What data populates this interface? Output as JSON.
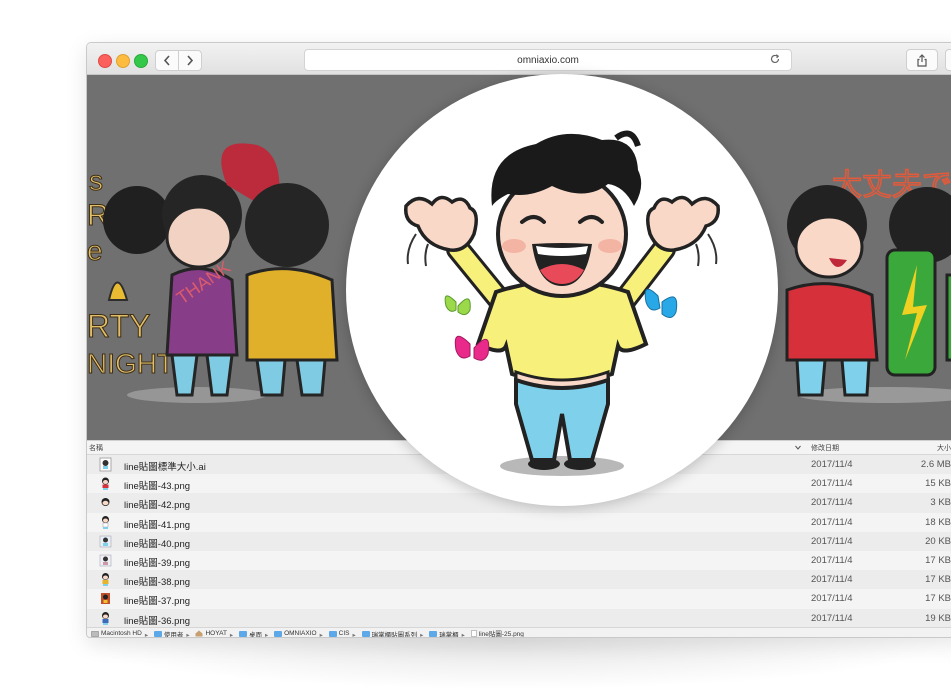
{
  "browser": {
    "url": "omniaxio.com"
  },
  "finder": {
    "columns": {
      "name": "名稱",
      "date": "修改日期",
      "size": "大小"
    },
    "files": [
      {
        "name": "line貼圖標準大小.ai",
        "date": "2017/11/4",
        "size": "2.6 MB"
      },
      {
        "name": "line貼圖-43.png",
        "date": "2017/11/4",
        "size": "15 KB"
      },
      {
        "name": "line貼圖-42.png",
        "date": "2017/11/4",
        "size": "3 KB"
      },
      {
        "name": "line貼圖-41.png",
        "date": "2017/11/4",
        "size": "18 KB"
      },
      {
        "name": "line貼圖-40.png",
        "date": "2017/11/4",
        "size": "20 KB"
      },
      {
        "name": "line貼圖-39.png",
        "date": "2017/11/4",
        "size": "17 KB"
      },
      {
        "name": "line貼圖-38.png",
        "date": "2017/11/4",
        "size": "17 KB"
      },
      {
        "name": "line貼圖-37.png",
        "date": "2017/11/4",
        "size": "17 KB"
      },
      {
        "name": "line貼圖-36.png",
        "date": "2017/11/4",
        "size": "19 KB"
      }
    ],
    "path": [
      "Macintosh HD",
      "使用者",
      "HOYAT",
      "桌面",
      "OMNIAXIO",
      "CIS",
      "瑞掌櫃貼圖系列",
      "瑞掌櫃",
      "line貼圖-25.png"
    ]
  },
  "colors": {
    "preview_bg": "#707070",
    "yellow_shirt": "#f7f07a",
    "jeans": "#7fd0ea",
    "hair": "#1a1a1a",
    "skin": "#f9d8c8",
    "butterfly_green": "#9bd84a",
    "butterfly_pink": "#ea2a8a",
    "butterfly_blue": "#28a8e6"
  }
}
